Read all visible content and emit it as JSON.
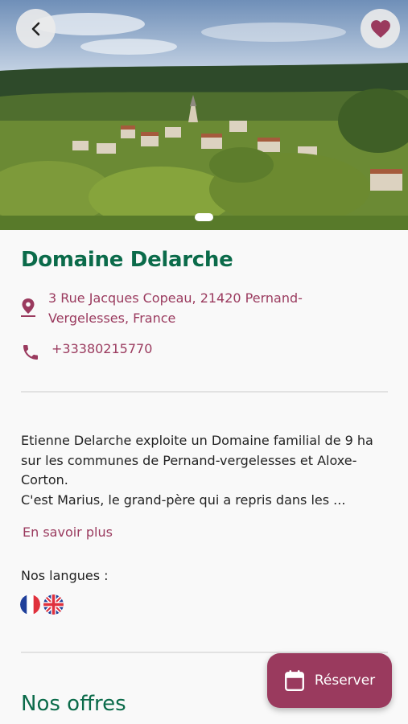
{
  "header": {
    "back_icon": "chevron-left-icon",
    "favorite_icon": "heart-icon",
    "favorite_color": "#9a3a5e",
    "carousel": {
      "pages": 1,
      "active": 1
    }
  },
  "domain": {
    "name": "Domaine Delarche",
    "address": "3 Rue Jacques Copeau, 21420 Pernand-Vergelesses, France",
    "phone": "+33380215770"
  },
  "description": {
    "lines": [
      "Etienne Delarche exploite un Domaine familial de 9 ha",
      "sur les communes de Pernand-vergelesses et Aloxe-",
      "Corton.",
      "C'est Marius, le grand-père qui a repris dans les ..."
    ],
    "more_label": "En savoir plus"
  },
  "languages": {
    "label": "Nos langues :",
    "flags": [
      "france-flag-icon",
      "uk-flag-icon"
    ]
  },
  "offers": {
    "title": "Nos offres"
  },
  "reserve": {
    "label": "Réserver",
    "icon": "calendar-icon"
  },
  "colors": {
    "brand_green": "#0b6b4a",
    "accent": "#9a3a5e"
  }
}
